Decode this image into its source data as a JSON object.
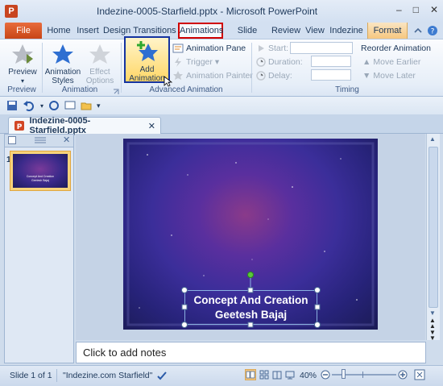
{
  "window": {
    "title": "Indezine-0005-Starfield.pptx - Microsoft PowerPoint",
    "app_icon_letter": "P",
    "controls": [
      "–",
      "□",
      "✕"
    ]
  },
  "tabs": [
    {
      "id": "file",
      "label": "File"
    },
    {
      "id": "home",
      "label": "Home"
    },
    {
      "id": "insert",
      "label": "Insert"
    },
    {
      "id": "design",
      "label": "Design"
    },
    {
      "id": "transitions",
      "label": "Transitions"
    },
    {
      "id": "animations",
      "label": "Animations",
      "active": true
    },
    {
      "id": "slideshow",
      "label": "Slide Show"
    },
    {
      "id": "review",
      "label": "Review"
    },
    {
      "id": "view",
      "label": "View"
    },
    {
      "id": "indezine",
      "label": "Indezine"
    },
    {
      "id": "format",
      "label": "Format"
    }
  ],
  "ribbon": {
    "preview": {
      "label": "Preview",
      "group": "Preview"
    },
    "animation_group": {
      "animation_styles": "Animation Styles",
      "effect_options": "Effect Options",
      "label": "Animation"
    },
    "advanced": {
      "add_animation": "Add Animation",
      "animation_pane": "Animation Pane",
      "trigger": "Trigger",
      "animation_painter": "Animation Painter",
      "label": "Advanced Animation"
    },
    "timing": {
      "start": "Start:",
      "duration": "Duration:",
      "delay": "Delay:",
      "reorder": "Reorder Animation",
      "move_earlier": "Move Earlier",
      "move_later": "Move Later",
      "label": "Timing"
    }
  },
  "document": {
    "tab_name": "Indezine-0005-Starfield.pptx"
  },
  "slides_pane": {
    "slide_number": "1"
  },
  "slide": {
    "title_line1": "Concept And Creation",
    "title_line2": "Geetesh Bajaj",
    "thumb_line1": "Concept And Creation",
    "thumb_line2": "Geetesh Bajaj"
  },
  "notes": {
    "placeholder": "Click to add notes"
  },
  "status": {
    "slide_info": "Slide 1 of 1",
    "theme": "\"Indezine.com Starfield\"",
    "zoom": "40%"
  },
  "colors": {
    "accent_red": "#d00000",
    "highlight_blue": "#1433a0",
    "file_tab": "#c84516"
  }
}
